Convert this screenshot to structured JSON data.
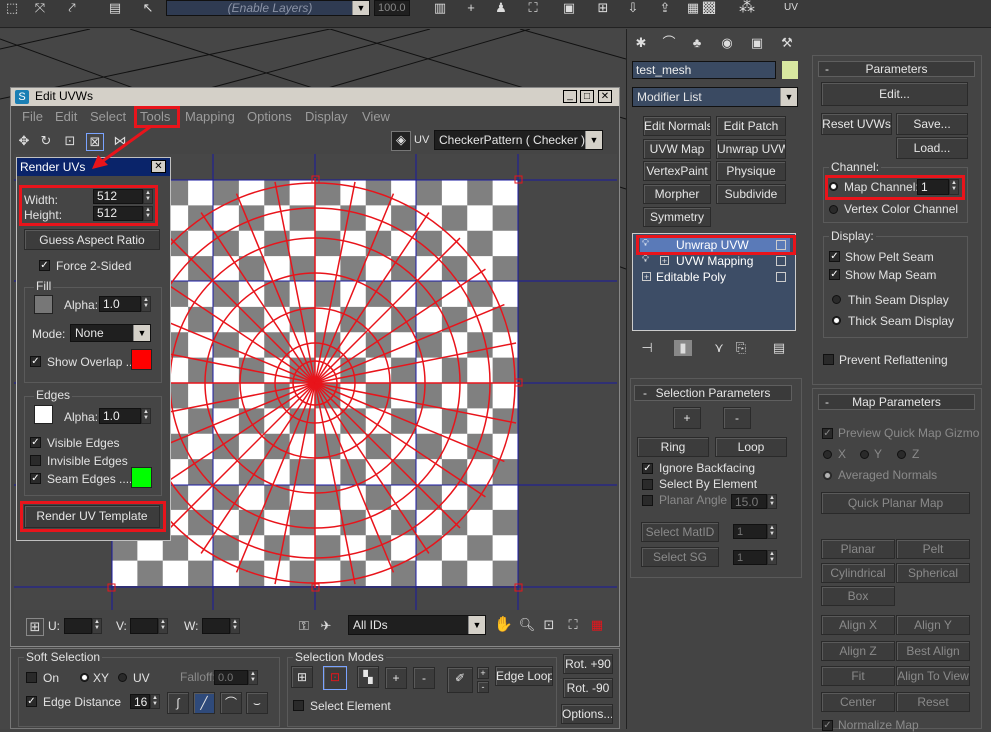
{
  "colors": {
    "accent_red": "#e8141b",
    "fill_swatch": "#777777",
    "overlap_swatch": "#ff0000",
    "edge_swatch": "#ffffff",
    "seam_swatch": "#00ff00",
    "title_blue": "#0a246a"
  },
  "toolbar": {
    "layers_dropdown": "(Enable Layers)",
    "opacity_value": "100.0"
  },
  "edit_uvws": {
    "title": "Edit UVWs",
    "menu": [
      "File",
      "Edit",
      "Select",
      "Tools",
      "Mapping",
      "Options",
      "Display",
      "View"
    ],
    "texture_label": "UV",
    "texture_dropdown": "CheckerPattern  ( Checker )",
    "u_label": "U:",
    "v_label": "V:",
    "w_label": "W:",
    "ids_dropdown": "All IDs"
  },
  "render_uvs": {
    "title": "Render UVs",
    "width_label": "Width:",
    "width_value": "512",
    "height_label": "Height:",
    "height_value": "512",
    "guess_button": "Guess Aspect Ratio",
    "force_2sided": "Force 2-Sided",
    "fill_group": "Fill",
    "alpha_label": "Alpha:",
    "fill_alpha": "1.0",
    "mode_label": "Mode:",
    "mode_value": "None",
    "show_overlap": "Show Overlap ...",
    "edges_group": "Edges",
    "edge_alpha": "1.0",
    "visible_edges": "Visible Edges",
    "invisible_edges": "Invisible Edges",
    "seam_edges": "Seam Edges ....",
    "render_button": "Render UV Template"
  },
  "bottom": {
    "soft_selection": "Soft Selection",
    "on": "On",
    "xy": "XY",
    "uv": "UV",
    "falloff": "Falloff:",
    "falloff_value": "0.0",
    "edge_distance": "Edge Distance",
    "edge_distance_value": "16",
    "selection_modes": "Selection Modes",
    "plus": "+",
    "minus": "-",
    "edge_loop": "Edge Loop",
    "select_element": "Select Element",
    "rot_p90": "Rot. +90",
    "rot_m90": "Rot. -90",
    "options": "Options..."
  },
  "modifier_panel": {
    "object_name": "test_mesh",
    "modifier_list": "Modifier List",
    "buttons": [
      "Edit Normals",
      "Edit Patch",
      "UVW Map",
      "Unwrap UVW",
      "VertexPaint",
      "Physique",
      "Morpher",
      "Subdivide",
      "Symmetry"
    ],
    "stack": [
      "Unwrap UVW",
      "UVW Mapping",
      "Editable Poly"
    ]
  },
  "selection_params": {
    "title": "Selection Parameters",
    "plus": "+",
    "minus": "-",
    "ring": "Ring",
    "loop": "Loop",
    "ignore_backfacing": "Ignore Backfacing",
    "select_by_element": "Select By Element",
    "planar_angle": "Planar Angle",
    "planar_angle_value": "15.0",
    "select_matid": "Select MatID",
    "select_sg": "Select SG",
    "matid_value": "1",
    "sg_value": "1"
  },
  "parameters": {
    "title": "Parameters",
    "edit": "Edit...",
    "reset": "Reset UVWs",
    "save": "Save...",
    "load": "Load...",
    "channel": "Channel:",
    "map_channel": "Map Channel:",
    "map_channel_value": "1",
    "vertex_color": "Vertex Color Channel",
    "display": "Display:",
    "show_pelt": "Show Pelt Seam",
    "show_map": "Show Map Seam",
    "thin": "Thin Seam Display",
    "thick": "Thick Seam Display",
    "prevent": "Prevent Reflattening"
  },
  "map_params": {
    "title": "Map Parameters",
    "preview": "Preview Quick Map Gizmo",
    "x": "X",
    "y": "Y",
    "z": "Z",
    "averaged": "Averaged Normals",
    "quick_planar": "Quick Planar Map",
    "grid": [
      "Planar",
      "Pelt",
      "Cylindrical",
      "Spherical",
      "Box"
    ],
    "align": [
      "Align X",
      "Align Y",
      "Align Z",
      "Best Align",
      "Fit",
      "Align To View",
      "Center",
      "Reset"
    ],
    "normalize": "Normalize Map"
  }
}
